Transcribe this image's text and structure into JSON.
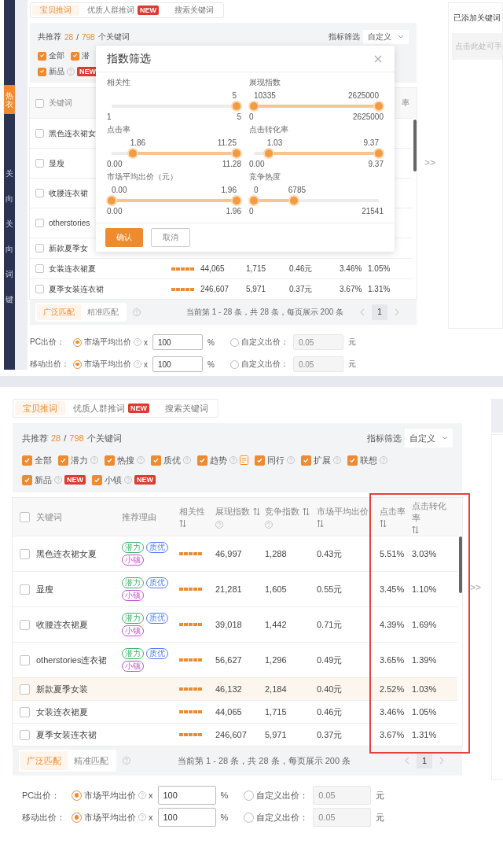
{
  "screenshots": [
    {
      "sidebar": {
        "items": [
          {
            "label": "热衣",
            "selected": true
          },
          {
            "label": "关",
            "selected": false
          },
          {
            "label": "向",
            "selected": false
          },
          {
            "label": "关",
            "selected": false
          },
          {
            "label": "向",
            "selected": false
          },
          {
            "label": "词",
            "selected": false
          },
          {
            "label": "键",
            "selected": false
          }
        ]
      },
      "tabs": [
        {
          "label": "宝贝推词",
          "selected": true
        },
        {
          "label": "优质人群推词",
          "badge": "NEW",
          "selected": false
        },
        {
          "label": "搜索关键词",
          "selected": false
        }
      ],
      "summary": {
        "prefix": "共推荐",
        "count": "28",
        "separator": "/",
        "total": "798",
        "suffix": "个关键词",
        "filter_label": "指标筛选",
        "filter_value": "自定义",
        "filter_rows": [
          [
            {
              "label": "全部",
              "checked": true
            },
            {
              "label": "潜",
              "checked": true
            }
          ],
          [
            {
              "label": "新品",
              "checked": true,
              "help": true,
              "badge": "NEW"
            }
          ]
        ]
      },
      "table": {
        "header": {
          "keyword": {
            "label": "关键词",
            "checked": false
          },
          "cvr": {
            "label": "率"
          }
        },
        "rows": [
          {
            "keyword": "黑色连衣裙女",
            "checked": false,
            "highlighted": false
          },
          {
            "keyword": "显瘦",
            "checked": false,
            "highlighted": false
          },
          {
            "keyword": "收腰连衣裙",
            "checked": false,
            "highlighted": false
          },
          {
            "keyword": "otherstories",
            "checked": false,
            "highlighted": false
          },
          {
            "keyword": "新款夏季女",
            "checked": false,
            "highlighted": false
          },
          {
            "keyword": "女装连衣裙夏",
            "checked": false,
            "highlighted": false,
            "stars": 5,
            "impressions": "44,065",
            "competition": "1,715",
            "avg_bid": "0.46元",
            "ctr": "3.46%",
            "cvr": "1.05%"
          },
          {
            "keyword": "夏季女装连衣裙",
            "checked": false,
            "highlighted": false,
            "stars": 5,
            "impressions": "246,607",
            "competition": "5,971",
            "avg_bid": "0.37元",
            "ctr": "3.67%",
            "cvr": "1.31%"
          }
        ]
      },
      "pager": {
        "match_types": [
          {
            "label": "广泛匹配",
            "selected": true
          },
          {
            "label": "精准匹配",
            "selected": false
          }
        ],
        "help": true,
        "info": "当前第 1 - 28 条，共 28 条，每页展示 200 条",
        "prev": {
          "disabled": true
        },
        "pages": [
          {
            "label": "1",
            "selected": true
          }
        ],
        "next": {
          "disabled": true
        }
      },
      "bids": [
        {
          "label": "PC出价：",
          "market": {
            "label": "市场平均出价",
            "selected": true,
            "help": true,
            "times": "x",
            "value": "100",
            "unit": "%"
          },
          "custom": {
            "label": "自定义出价：",
            "selected": false,
            "placeholder": "0.05",
            "disabled": true,
            "unit": "元"
          }
        },
        {
          "label": "移动出价：",
          "market": {
            "label": "市场平均出价",
            "selected": true,
            "help": true,
            "times": "x",
            "value": "100",
            "unit": "%"
          },
          "custom": {
            "label": "自定义出价：",
            "selected": false,
            "placeholder": "0.05",
            "disabled": true,
            "unit": "元"
          }
        }
      ],
      "expand_button": ">>",
      "side_panel": {
        "kind": "keywords",
        "title": "已添加关键词",
        "hint": "点击此处可手"
      },
      "modal": {
        "title": "指数筛选",
        "sliders": [
          {
            "label": "相关性",
            "thumbs": [
              {
                "value": "5",
                "level": 1
              }
            ],
            "min": "1",
            "max": "5"
          },
          {
            "label": "展现指数",
            "thumbs": [
              {
                "value": "10335",
                "level": 0
              },
              {
                "value": "2625000",
                "level": 1
              }
            ],
            "min": "0",
            "max": "2625000"
          },
          {
            "label": "点击率",
            "thumbs": [
              {
                "value": "1.86",
                "level": 0.17
              },
              {
                "value": "11.25",
                "level": 1
              }
            ],
            "min": "0.00",
            "max": "11.28"
          },
          {
            "label": "点击转化率",
            "thumbs": [
              {
                "value": "1.03",
                "level": 0.12
              },
              {
                "value": "9.37",
                "level": 1
              }
            ],
            "min": "0.00",
            "max": "9.37"
          },
          {
            "label": "市场平均出价（元）",
            "thumbs": [
              {
                "value": "0.00",
                "level": 0
              },
              {
                "value": "1.96",
                "level": 1
              }
            ],
            "min": "0.00",
            "max": "1.96"
          },
          {
            "label": "竞争热度",
            "thumbs": [
              {
                "value": "0",
                "level": 0
              },
              {
                "value": "6785",
                "level": 0.32
              }
            ],
            "min": "0",
            "max": "21541"
          }
        ],
        "buttons": [
          {
            "label": "确认",
            "kind": "primary"
          },
          {
            "label": "取消",
            "kind": "secondary"
          }
        ]
      }
    },
    {
      "tabs": [
        {
          "label": "宝贝推词",
          "selected": true
        },
        {
          "label": "优质人群推词",
          "badge": "NEW",
          "selected": false
        },
        {
          "label": "搜索关键词",
          "selected": false
        }
      ],
      "summary": {
        "prefix": "共推荐",
        "count": "28",
        "separator": "/",
        "total": "798",
        "suffix": "个关键词",
        "filter_label": "指标筛选",
        "filter_value": "自定义",
        "filter_rows": [
          [
            {
              "label": "全部",
              "checked": true
            },
            {
              "label": "潜力",
              "checked": true,
              "help": true
            },
            {
              "label": "热搜",
              "checked": true,
              "help": true
            },
            {
              "label": "质优",
              "checked": true,
              "help": true
            },
            {
              "label": "趋势",
              "checked": true,
              "help": true,
              "note": true
            },
            {
              "label": "同行",
              "checked": true,
              "help": true
            },
            {
              "label": "扩展",
              "checked": true,
              "help": true
            },
            {
              "label": "联想",
              "checked": true,
              "help": true
            }
          ],
          [
            {
              "label": "新品",
              "checked": true,
              "help": true,
              "badge": "NEW"
            },
            {
              "label": "小镇",
              "checked": true,
              "help": true,
              "badge": "NEW"
            }
          ]
        ]
      },
      "table": {
        "header": {
          "keyword": {
            "label": "关键词",
            "checked": false
          },
          "reason": {
            "label": "推荐理由"
          },
          "relevance": {
            "label": "相关性",
            "sortable": true
          },
          "impressions": {
            "label": "展现指数",
            "sortable": true,
            "help": true
          },
          "competition": {
            "label": "竞争指数",
            "sortable": true,
            "help": true
          },
          "avg_bid": {
            "label": "市场平均出价",
            "sortable": true
          },
          "ctr": {
            "label": "点击率",
            "sortable": true,
            "highlighted": true
          },
          "cvr": {
            "label": "点击转化率",
            "sortable": true,
            "highlighted": true
          }
        },
        "rows": [
          {
            "keyword": "黑色连衣裙女夏",
            "checked": false,
            "highlighted": false,
            "tags": [
              {
                "label": "潜力",
                "color": "#3bb36a"
              },
              {
                "label": "质优",
                "color": "#4d7cf3"
              },
              {
                "label": "小镇",
                "color": "#c34fcf"
              }
            ],
            "stars": 5,
            "impressions": "46,997",
            "competition": "1,288",
            "avg_bid": "0.43元",
            "ctr": "5.51%",
            "cvr": "3.03%"
          },
          {
            "keyword": "显瘦",
            "checked": false,
            "highlighted": false,
            "tags": [
              {
                "label": "潜力",
                "color": "#3bb36a"
              },
              {
                "label": "质优",
                "color": "#4d7cf3"
              },
              {
                "label": "小镇",
                "color": "#c34fcf"
              }
            ],
            "stars": 5,
            "impressions": "21,281",
            "competition": "1,605",
            "avg_bid": "0.55元",
            "ctr": "3.45%",
            "cvr": "1.10%"
          },
          {
            "keyword": "收腰连衣裙夏",
            "checked": false,
            "highlighted": false,
            "tags": [
              {
                "label": "潜力",
                "color": "#3bb36a"
              },
              {
                "label": "质优",
                "color": "#4d7cf3"
              },
              {
                "label": "小镇",
                "color": "#c34fcf"
              }
            ],
            "stars": 5,
            "impressions": "39,018",
            "competition": "1,442",
            "avg_bid": "0.71元",
            "ctr": "4.39%",
            "cvr": "1.69%"
          },
          {
            "keyword": "otherstories连衣裙",
            "checked": false,
            "highlighted": false,
            "tags": [
              {
                "label": "潜力",
                "color": "#3bb36a"
              },
              {
                "label": "质优",
                "color": "#4d7cf3"
              },
              {
                "label": "小镇",
                "color": "#c34fcf"
              }
            ],
            "stars": 5,
            "impressions": "56,627",
            "competition": "1,296",
            "avg_bid": "0.49元",
            "ctr": "3.65%",
            "cvr": "1.39%"
          },
          {
            "keyword": "新款夏季女装",
            "checked": false,
            "highlighted": true,
            "stars": 5,
            "impressions": "46,132",
            "competition": "2,184",
            "avg_bid": "0.40元",
            "ctr": "2.52%",
            "cvr": "1.03%"
          },
          {
            "keyword": "女装连衣裙夏",
            "checked": false,
            "highlighted": false,
            "stars": 5,
            "impressions": "44,065",
            "competition": "1,715",
            "avg_bid": "0.46元",
            "ctr": "3.46%",
            "cvr": "1.05%"
          },
          {
            "keyword": "夏季女装连衣裙",
            "checked": false,
            "highlighted": false,
            "stars": 5,
            "impressions": "246,607",
            "competition": "5,971",
            "avg_bid": "0.37元",
            "ctr": "3.67%",
            "cvr": "1.31%"
          }
        ]
      },
      "pager": {
        "match_types": [
          {
            "label": "广泛匹配",
            "selected": true
          },
          {
            "label": "精准匹配",
            "selected": false
          }
        ],
        "help": true,
        "info": "当前第 1 - 28 条，共 28 条，每页展示 200 条",
        "prev": {
          "disabled": true
        },
        "pages": [
          {
            "label": "1",
            "selected": true
          }
        ],
        "next": {
          "disabled": true
        }
      },
      "bids": [
        {
          "label": "PC出价：",
          "market": {
            "label": "市场平均出价",
            "selected": true,
            "help": true,
            "times": "x",
            "value": "100",
            "unit": "%"
          },
          "custom": {
            "label": "自定义出价：",
            "selected": false,
            "placeholder": "0.05",
            "disabled": true,
            "unit": "元"
          }
        },
        {
          "label": "移动出价：",
          "market": {
            "label": "市场平均出价",
            "selected": true,
            "help": true,
            "times": "x",
            "value": "100",
            "unit": "%"
          },
          "custom": {
            "label": "自定义出价：",
            "selected": false,
            "placeholder": "0.05",
            "disabled": true,
            "unit": "元"
          }
        }
      ],
      "expand_button": ">>",
      "side_panel": {
        "kind": "collapsed"
      }
    }
  ]
}
